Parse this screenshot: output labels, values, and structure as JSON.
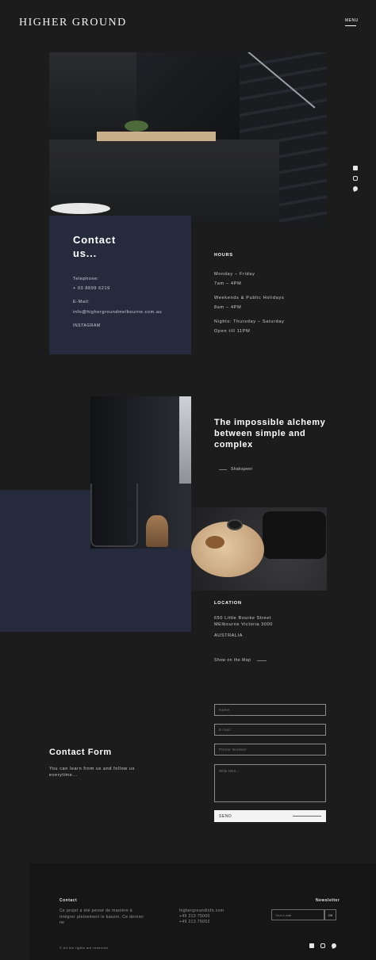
{
  "header": {
    "logo": "HIGHER GROUND",
    "menu_label": "MENU"
  },
  "side_social": {
    "icons": [
      "facebook-icon",
      "instagram-icon",
      "twitter-icon"
    ]
  },
  "contact": {
    "title": "Contact us...",
    "telephone_label": "Telephone:",
    "telephone_value": "+ 03 8899 6219",
    "email_label": "E-Mail:",
    "email_value": "info@highergroundmelbourne.com.au",
    "instagram": "INSTAGRAM"
  },
  "hours": {
    "title": "HOURS",
    "lines": [
      "Monday – Friday",
      "7am – 4PM",
      "Weekends & Public Holidays",
      "8am – 4PM",
      "Nights: Thursday – Saturday",
      "Open till 11PM"
    ]
  },
  "feature": {
    "heading": "The impossible alchemy between simple and complex",
    "author": "Shakspeer"
  },
  "location": {
    "title": "LOCATION",
    "address_line1": "650 Little Bourke Street",
    "address_line2": "MElbourne Victoria 3000",
    "country": "AUSTRALIA",
    "map_link": "Show on the Map"
  },
  "contact_form": {
    "title": "Contact Form",
    "subtitle": "You can learn from us and follow us everytime...",
    "name_placeholder": "Name",
    "email_placeholder": "E-mail",
    "phone_placeholder": "Phone Number",
    "message_placeholder": "Write Here...",
    "send_label": "SEND"
  },
  "footer": {
    "contact_heading": "Contact",
    "description": "Ce projet a été pensé de manière à intégrer pleinement le bassin. Ce dernier ne",
    "email": "highergroundinfo.com",
    "phone1": "+49 213 75000",
    "phone2": "+49 213 75002",
    "newsletter_heading": "Newsletter",
    "newsletter_placeholder": "Your e-mail",
    "newsletter_button": "OK",
    "copyright": "© All the rights are reserved"
  },
  "colors": {
    "background": "#1c1c1c",
    "navy_accent": "#252a3d",
    "footer_bg": "#161616"
  }
}
